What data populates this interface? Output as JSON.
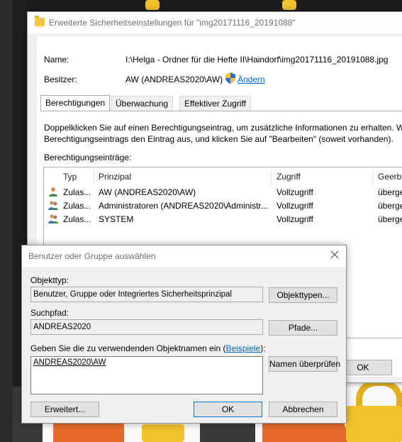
{
  "main_window": {
    "title": "Erweiterte Sicherheitseinstellungen für \"img20171116_20191088\"",
    "name_label": "Name:",
    "name_value": "I:\\Helga   -   Ordner für die Hefte II\\Haindorf\\img20171116_20191088.jpg",
    "owner_label": "Besitzer:",
    "owner_value": "AW (ANDREAS2020\\AW)",
    "change_link": "Ändern",
    "tabs": [
      "Berechtigungen",
      "Überwachung",
      "Effektiver Zugriff"
    ],
    "info_line1": "Doppelklicken Sie auf einen Berechtigungseintrag, um zusätzliche Informationen zu erhalten. Wä",
    "info_line2": "Berechtigungseintrags den Eintrag aus, und klicken Sie auf \"Bearbeiten\" (soweit vorhanden).",
    "entries_label": "Berechtigungseinträge:",
    "columns": [
      "Typ",
      "Prinzipal",
      "Zugriff",
      "Geerbt"
    ],
    "rows": [
      {
        "type": "Zulas...",
        "principal": "AW (ANDREAS2020\\AW)",
        "access": "Vollzugriff",
        "inherited": "überge"
      },
      {
        "type": "Zulas...",
        "principal": "Administratoren (ANDREAS2020\\Administr...",
        "access": "Vollzugriff",
        "inherited": "überge"
      },
      {
        "type": "Zulas...",
        "principal": "SYSTEM",
        "access": "Vollzugriff",
        "inherited": "überge"
      }
    ],
    "ok_label": "OK"
  },
  "dialog": {
    "title": "Benutzer oder Gruppe auswählen",
    "object_type_label": "Objekttyp:",
    "object_type_value": "Benutzer, Gruppe oder Integriertes Sicherheitsprinzipal",
    "object_types_button": "Objekttypen...",
    "search_path_label": "Suchpfad:",
    "search_path_value": "ANDREAS2020",
    "paths_button": "Pfade...",
    "enter_names_label": "Geben Sie die zu verwendenden Objektnamen ein (",
    "examples_link": "Beispiele",
    "enter_names_suffix": "):",
    "names_value": "ANDREAS2020\\AW",
    "check_names_button": "Namen überprüfen",
    "advanced_button": "Erweitert...",
    "ok_button": "OK",
    "cancel_button": "Abbrechen"
  },
  "icons": {
    "folder": "folder-icon",
    "shield": "uac-shield-icon",
    "user": "user-icon",
    "group": "group-icon",
    "close": "close-icon"
  },
  "colors": {
    "link": "#0066cc",
    "lock_yellow": "#f2c12e",
    "accent_orange": "#e66a2c"
  }
}
